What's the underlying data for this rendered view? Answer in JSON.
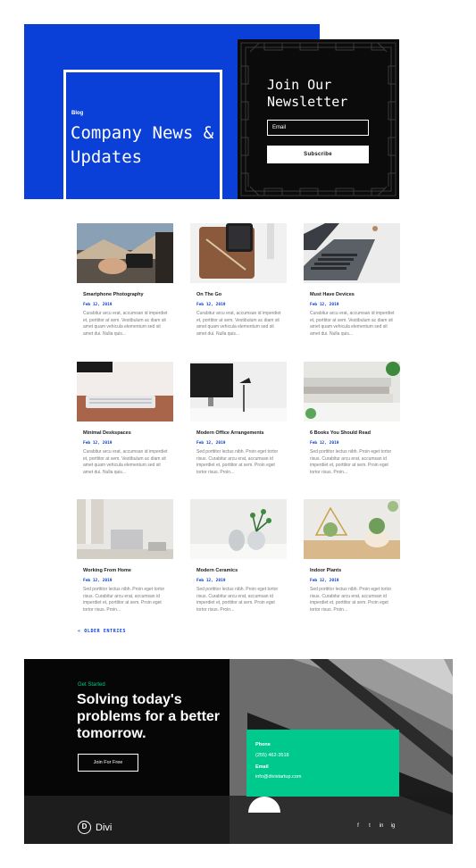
{
  "hero": {
    "eyebrow": "Blog",
    "title": "Company News & Updates",
    "brand_color": "#0a3fd8"
  },
  "newsletter": {
    "title": "Join Our Newsletter",
    "email_placeholder": "Email",
    "button_label": "Subscribe"
  },
  "posts": [
    {
      "title": "Smartphone Photography",
      "date": "Feb 12, 2019",
      "excerpt": "Curabitur arcu erat, accumsan id imperdiet et, porttitor at sem. Vestibulum ac diam sit amet quam vehicula elementum sed sit amet dui. Nulla quis...",
      "image": "phone-camera-photo"
    },
    {
      "title": "On The Go",
      "date": "Feb 12, 2019",
      "excerpt": "Curabitur arcu erat, accumsan id imperdiet et, porttitor at sem. Vestibulum ac diam sit amet quam vehicula elementum sed sit amet dui. Nulla quis...",
      "image": "phone-leather-case-photo"
    },
    {
      "title": "Must Have Devices",
      "date": "Feb 12, 2019",
      "excerpt": "Curabitur arcu erat, accumsan id imperdiet et, porttitor at sem. Vestibulum ac diam sit amet quam vehicula elementum sed sit amet dui. Nulla quis...",
      "image": "laptop-keyboard-photo"
    },
    {
      "title": "Minimal Deskspaces",
      "date": "Feb 12, 2019",
      "excerpt": "Curabitur arcu erat, accumsan id imperdiet et, porttitor at sem. Vestibulum ac diam sit amet quam vehicula elementum sed sit amet dui. Nulla quis...",
      "image": "keyboard-desk-photo"
    },
    {
      "title": "Modern Office Arrangements",
      "date": "Feb 12, 2019",
      "excerpt": "Sed porttitor lectus nibh. Proin eget tortor risus. Curabitur arcu erat, accumsan id imperdiet et, porttitor at sem. Proin eget tortor risus. Proin...",
      "image": "monitor-lamp-photo"
    },
    {
      "title": "6 Books You Should Read",
      "date": "Feb 12, 2019",
      "excerpt": "Sed porttitor lectus nibh. Proin eget tortor risus. Curabitur arcu erat, accumsan id imperdiet et, porttitor at sem. Proin eget tortor risus. Proin...",
      "image": "books-stack-photo"
    },
    {
      "title": "Working From Home",
      "date": "Feb 12, 2019",
      "excerpt": "Sed porttitor lectus nibh. Proin eget tortor risus. Curabitur arcu erat, accumsan id imperdiet et, porttitor at sem. Proin eget tortor risus. Proin...",
      "image": "home-office-photo"
    },
    {
      "title": "Modern Ceramics",
      "date": "Feb 12, 2019",
      "excerpt": "Sed porttitor lectus nibh. Proin eget tortor risus. Curabitur arcu erat, accumsan id imperdiet et, porttitor at sem. Proin eget tortor risus. Proin...",
      "image": "ceramic-vases-photo"
    },
    {
      "title": "Indoor Plants",
      "date": "Feb 12, 2019",
      "excerpt": "Sed porttitor lectus nibh. Proin eget tortor risus. Curabitur arcu erat, accumsan id imperdiet et, porttitor at sem. Proin eget tortor risus. Proin...",
      "image": "terrarium-plants-photo"
    }
  ],
  "pagination": {
    "older_label": "« OLDER ENTRIES"
  },
  "cta": {
    "eyebrow": "Get Started",
    "title": "Solving today's problems for a better tomorrow.",
    "button_label": "Join For Free",
    "accent_color": "#00c98d"
  },
  "contact": {
    "phone_label": "Phone",
    "phone_value": "(255) 462-3518",
    "email_label": "Email",
    "email_value": "info@divistartup.com"
  },
  "footer": {
    "logo_letter": "D",
    "logo_text": "Divi",
    "social_icons": [
      "f",
      "t",
      "in",
      "ig"
    ]
  }
}
